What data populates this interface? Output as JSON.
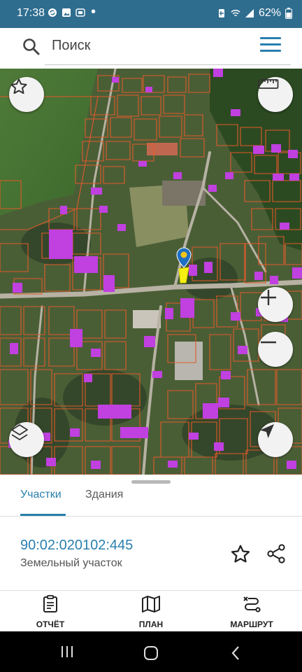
{
  "status_bar": {
    "time": "17:38",
    "battery": "62%",
    "icons": [
      "sync-icon",
      "image-icon",
      "notification-icon",
      "battery-saver-icon",
      "wifi-icon",
      "signal-icon",
      "battery-icon"
    ]
  },
  "search": {
    "placeholder": "Поиск"
  },
  "sheet": {
    "tabs": [
      {
        "label": "Участки",
        "active": true
      },
      {
        "label": "Здания",
        "active": false
      }
    ],
    "parcel": {
      "number": "90:02:020102:445",
      "type": "Земельный участок"
    },
    "actions": [
      {
        "label": "ОТЧЁТ",
        "icon": "report-icon"
      },
      {
        "label": "ПЛАН",
        "icon": "map-icon"
      },
      {
        "label": "МАРШРУТ",
        "icon": "route-icon"
      }
    ]
  },
  "colors": {
    "accent": "#2a7fae",
    "status_bar": "#2f6d8f",
    "parcel_outline": "#e05a2a",
    "building_fill": "#c040e0",
    "selected_parcel": "#f5f011"
  }
}
